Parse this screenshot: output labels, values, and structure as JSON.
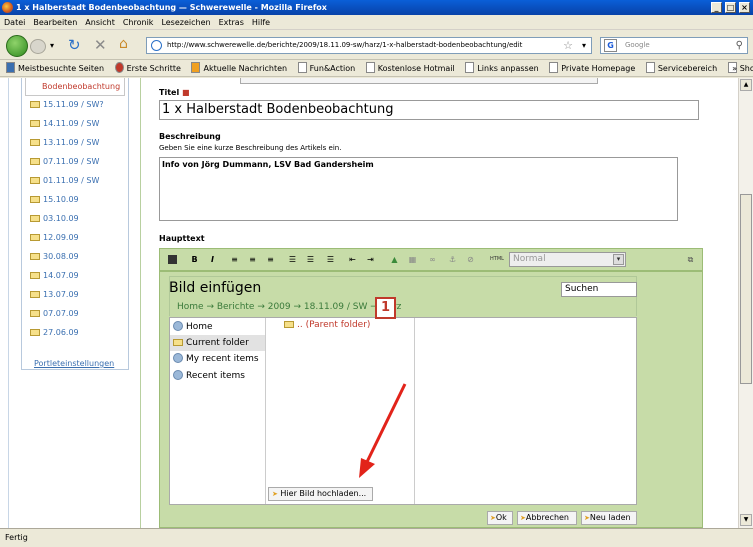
{
  "window": {
    "title": "1 x Halberstadt Bodenbeobachtung — Schwerewelle - Mozilla Firefox"
  },
  "menu": [
    "Datei",
    "Bearbeiten",
    "Ansicht",
    "Chronik",
    "Lesezeichen",
    "Extras",
    "Hilfe"
  ],
  "nav": {
    "url": "http://www.schwerewelle.de/berichte/2009/18.11.09-sw/harz/1-x-halberstadt-bodenbeobachtung/edit",
    "search_placeholder": "Google"
  },
  "bookmarks": [
    "Meistbesuchte Seiten",
    "Erste Schritte",
    "Aktuelle Nachrichten",
    "Fun&Action",
    "Kostenlose Hotmail",
    "Links anpassen",
    "Private Homepage",
    "Servicebereich",
    "Shopping"
  ],
  "sidebar": {
    "active": "Bodenbeobachtung",
    "items": [
      "15.11.09 / SW?",
      "14.11.09 / SW",
      "13.11.09 / SW",
      "07.11.09 / SW",
      "01.11.09 / SW",
      "15.10.09",
      "03.10.09",
      "12.09.09",
      "30.08.09",
      "14.07.09",
      "13.07.09",
      "07.07.09",
      "27.06.09"
    ],
    "portlet_link": "Portleteinstellungen"
  },
  "form": {
    "title_label": "Titel",
    "title_value": "1 x Halberstadt Bodenbeobachtung",
    "desc_label": "Beschreibung",
    "desc_help": "Geben Sie eine kurze Beschreibung des Artikels ein.",
    "desc_value": "Info von Jörg Dummann, LSV Bad Gandersheim",
    "body_label": "Haupttext",
    "format_select": "Normal"
  },
  "dialog": {
    "title": "Bild einfügen",
    "search": "Suchen",
    "breadcrumb": "Home → Berichte → 2009 → 18.11.09 / SW → Harz",
    "nav_items": [
      "Home",
      "Current folder",
      "My recent items",
      "Recent items"
    ],
    "parent_folder": ".. (Parent folder)",
    "upload_button": "Hier Bild hochladen...",
    "ok": "Ok",
    "cancel": "Abbrechen",
    "reload": "Neu laden"
  },
  "annotation": {
    "number": "1"
  },
  "status": "Fertig",
  "colors": {
    "accent_red": "#c0392b",
    "dialog_green": "#c7dca8"
  }
}
